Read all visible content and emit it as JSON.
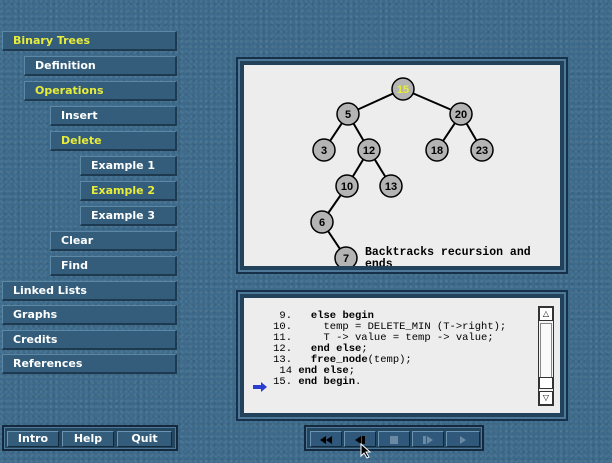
{
  "nav": {
    "binary_trees": "Binary Trees",
    "definition": "Definition",
    "operations": "Operations",
    "insert": "Insert",
    "delete": "Delete",
    "example1": "Example 1",
    "example2": "Example 2",
    "example3": "Example 3",
    "clear": "Clear",
    "find": "Find",
    "linked_lists": "Linked Lists",
    "graphs": "Graphs",
    "credits": "Credits",
    "references": "References"
  },
  "bottom": {
    "intro": "Intro",
    "help": "Help",
    "quit": "Quit"
  },
  "player_icons": [
    "rewind-icon",
    "step-back-icon",
    "stop-icon",
    "step-forward-icon",
    "play-icon"
  ],
  "tree": {
    "nodes": [
      {
        "id": "n15",
        "label": "15",
        "highlight": true
      },
      {
        "id": "n5",
        "label": "5"
      },
      {
        "id": "n20",
        "label": "20"
      },
      {
        "id": "n3",
        "label": "3"
      },
      {
        "id": "n12",
        "label": "12"
      },
      {
        "id": "n18",
        "label": "18"
      },
      {
        "id": "n23",
        "label": "23"
      },
      {
        "id": "n10",
        "label": "10"
      },
      {
        "id": "n13",
        "label": "13"
      },
      {
        "id": "n6",
        "label": "6"
      },
      {
        "id": "n7",
        "label": "7"
      }
    ],
    "edges": [
      [
        "n15",
        "n5"
      ],
      [
        "n15",
        "n20"
      ],
      [
        "n5",
        "n3"
      ],
      [
        "n5",
        "n12"
      ],
      [
        "n20",
        "n18"
      ],
      [
        "n20",
        "n23"
      ],
      [
        "n12",
        "n10"
      ],
      [
        "n12",
        "n13"
      ],
      [
        "n10",
        "n6"
      ],
      [
        "n6",
        "n7"
      ]
    ],
    "caption_line1": "Backtracks recursion and",
    "caption_line2": "ends",
    "highlight_color": "#e8ec3a",
    "node_color": "#b4b4b4"
  },
  "code": {
    "lines": [
      {
        "num": "9.",
        "text": "   else begin"
      },
      {
        "num": "10.",
        "text": "     temp = DELETE_MIN (T->right);"
      },
      {
        "num": "11.",
        "text": "     T -> value = temp -> value;"
      },
      {
        "num": "12.",
        "text": "   end else;"
      },
      {
        "num": "13.",
        "text": "   free_node(temp);"
      },
      {
        "num": "14",
        "text": " end else;"
      },
      {
        "num": "15.",
        "text": " end begin."
      }
    ],
    "current_line": "15.",
    "arrow_color": "#2a3fd0"
  },
  "colors": {
    "active_text": "#e8ec3a",
    "nav_text": "#ffffff"
  }
}
